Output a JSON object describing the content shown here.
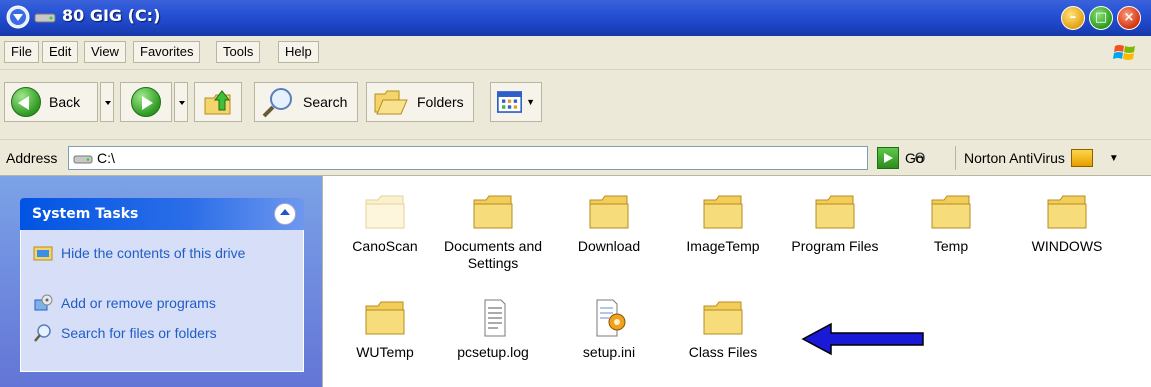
{
  "window": {
    "title": "80 GIG (C:)",
    "buttons": {
      "minimize": "–",
      "maximize": "□",
      "close": "×"
    }
  },
  "menubar": {
    "items": [
      "File",
      "Edit",
      "View",
      "Favorites",
      "Tools",
      "Help"
    ]
  },
  "toolbar": {
    "back_label": "Back",
    "search_label": "Search",
    "folders_label": "Folders"
  },
  "addressbar": {
    "label": "Address",
    "value": "C:\\",
    "go_label": "Go",
    "norton_label": "Norton AntiVirus"
  },
  "system_tasks": {
    "title": "System Tasks",
    "items": [
      {
        "label": "Hide the contents of this drive",
        "icon": "hide-contents-icon"
      },
      {
        "label": "Add or remove programs",
        "icon": "add-remove-programs-icon"
      },
      {
        "label": "Search for files or folders",
        "icon": "search-icon"
      }
    ]
  },
  "files": [
    {
      "name": "CanoScan",
      "type": "folder-faded"
    },
    {
      "name": "Documents and Settings",
      "type": "folder"
    },
    {
      "name": "Download",
      "type": "folder"
    },
    {
      "name": "ImageTemp",
      "type": "folder"
    },
    {
      "name": "Program Files",
      "type": "folder"
    },
    {
      "name": "Temp",
      "type": "folder"
    },
    {
      "name": "WINDOWS",
      "type": "folder"
    },
    {
      "name": "WUTemp",
      "type": "folder"
    },
    {
      "name": "pcsetup.log",
      "type": "text-file"
    },
    {
      "name": "setup.ini",
      "type": "ini-file"
    },
    {
      "name": "Class Files",
      "type": "folder"
    }
  ],
  "colors": {
    "titlebar": "#1d44c4",
    "chrome": "#ece9d8",
    "task_link": "#215dc6",
    "arrow": "#1a1ad6"
  }
}
